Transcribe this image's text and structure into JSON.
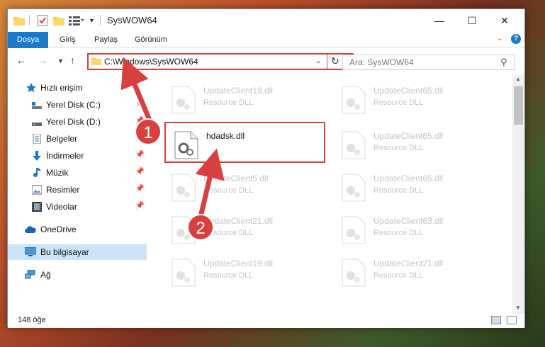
{
  "window": {
    "title": "SysWOW64"
  },
  "ribbon": {
    "tabs": [
      "Dosya",
      "Giriş",
      "Paylaş",
      "Görünüm"
    ],
    "help": "?"
  },
  "titlebar": {
    "minimize": "—",
    "maximize": "☐",
    "close": "✕"
  },
  "address": {
    "path": "C:\\Windows\\SysWOW64"
  },
  "search": {
    "placeholder": "Ara: SysWOW64"
  },
  "sidebar": {
    "items": [
      {
        "label": "Hızlı erişim",
        "icon": "star-icon"
      },
      {
        "label": "Yerel Disk (C:)",
        "icon": "drive-icon"
      },
      {
        "label": "Yerel Disk (D:)",
        "icon": "drive-icon"
      },
      {
        "label": "Belgeler",
        "icon": "document-icon"
      },
      {
        "label": "İndirmeler",
        "icon": "download-icon"
      },
      {
        "label": "Müzik",
        "icon": "music-icon"
      },
      {
        "label": "Resimler",
        "icon": "picture-icon"
      },
      {
        "label": "Videolar",
        "icon": "video-icon"
      },
      {
        "label": "OneDrive",
        "icon": "cloud-icon"
      },
      {
        "label": "Bu bilgisayar",
        "icon": "computer-icon"
      },
      {
        "label": "Ağ",
        "icon": "network-icon"
      }
    ]
  },
  "files": [
    {
      "name": "UpdateClient19.dll",
      "type": "Resource DLL"
    },
    {
      "name": "UpdateClient65.dll",
      "type": "Resource DLL"
    },
    {
      "name": "hdadsk.dll",
      "type": ""
    },
    {
      "name": "UpdateClient65.dll",
      "type": "Resource DLL"
    },
    {
      "name": "UpdateClient5.dll",
      "type": "Resource DLL"
    },
    {
      "name": "UpdateClient65.dll",
      "type": "Resource DLL"
    },
    {
      "name": "UpdateClient21.dll",
      "type": "Resource DLL"
    },
    {
      "name": "UpdateClient63.dll",
      "type": "Resource DLL"
    },
    {
      "name": "UpdateClient19.dll",
      "type": "Resource DLL"
    },
    {
      "name": "UpdateClient21.dll",
      "type": "Resource DLL"
    }
  ],
  "status": {
    "count": "148 öğe"
  },
  "annotations": {
    "step1": "1",
    "step2": "2"
  },
  "colors": {
    "accent": "#1979ca",
    "highlight": "#d84040",
    "selected": "#cce4f7"
  }
}
